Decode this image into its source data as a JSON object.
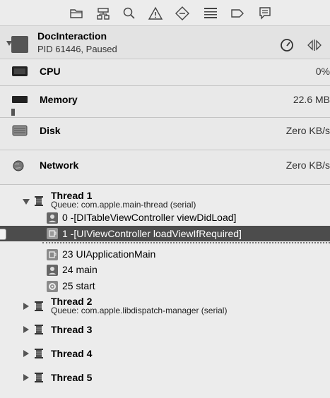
{
  "toolbar": {
    "icons": [
      "folder-icon",
      "hierarchy-icon",
      "search-icon",
      "warning-icon",
      "breakpoint-diamond-icon",
      "list-icon",
      "tag-icon",
      "comment-icon"
    ]
  },
  "process": {
    "name": "DocInteraction",
    "status": "PID 61446, Paused"
  },
  "gauges": [
    {
      "label": "CPU",
      "value": "0%"
    },
    {
      "label": "Memory",
      "value": "22.6 MB"
    },
    {
      "label": "Disk",
      "value": "Zero KB/s"
    },
    {
      "label": "Network",
      "value": "Zero KB/s"
    }
  ],
  "threads": [
    {
      "name": "Thread 1",
      "queue": "Queue: com.apple.main-thread (serial)",
      "expanded": true,
      "frames": [
        {
          "label": "0 -[DITableViewController viewDidLoad]",
          "kind": "user"
        },
        {
          "label": "1 -[UIViewController loadViewIfRequired]",
          "kind": "system",
          "selected": true
        },
        {
          "label": "23 UIApplicationMain",
          "kind": "system"
        },
        {
          "label": "24 main",
          "kind": "user"
        },
        {
          "label": "25 start",
          "kind": "start"
        }
      ]
    },
    {
      "name": "Thread 2",
      "queue": "Queue: com.apple.libdispatch-manager (serial)",
      "expanded": false
    },
    {
      "name": "Thread 3",
      "expanded": false
    },
    {
      "name": "Thread 4",
      "expanded": false
    },
    {
      "name": "Thread 5",
      "expanded": false
    }
  ],
  "colors": {
    "selection": "#4c4c4c",
    "background": "#ececec"
  }
}
